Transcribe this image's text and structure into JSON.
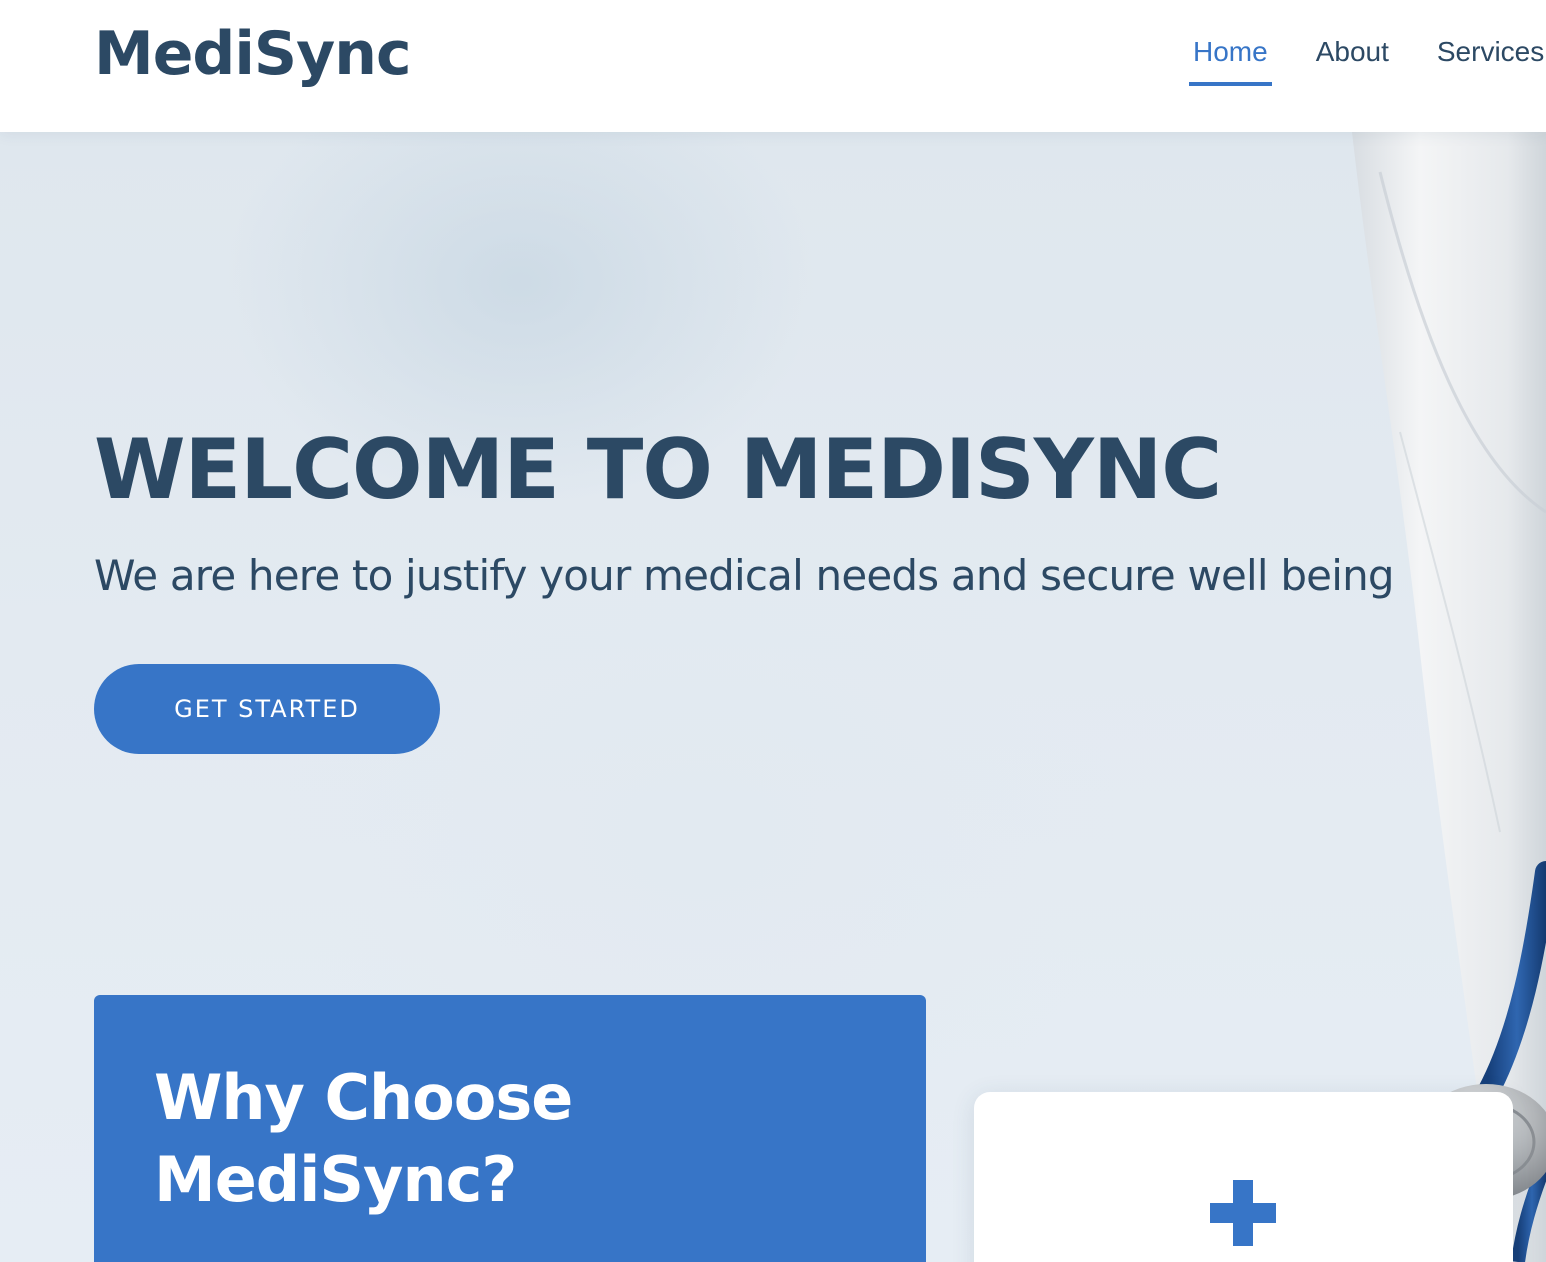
{
  "brand": {
    "name": "MediSync"
  },
  "nav": {
    "items": [
      {
        "label": "Home",
        "active": true
      },
      {
        "label": "About",
        "active": false
      },
      {
        "label": "Services",
        "active": false
      }
    ]
  },
  "hero": {
    "title": "WELCOME TO MEDISYNC",
    "subtitle": "We are here to justify your medical needs and secure well being",
    "cta_label": "GET STARTED"
  },
  "why": {
    "title": "Why Choose MediSync?"
  },
  "card": {
    "icon": "plus-icon"
  },
  "colors": {
    "accent": "#3775c7",
    "text": "#2c4964",
    "hero_background": "#e3eaf1",
    "card_background": "#ffffff"
  }
}
